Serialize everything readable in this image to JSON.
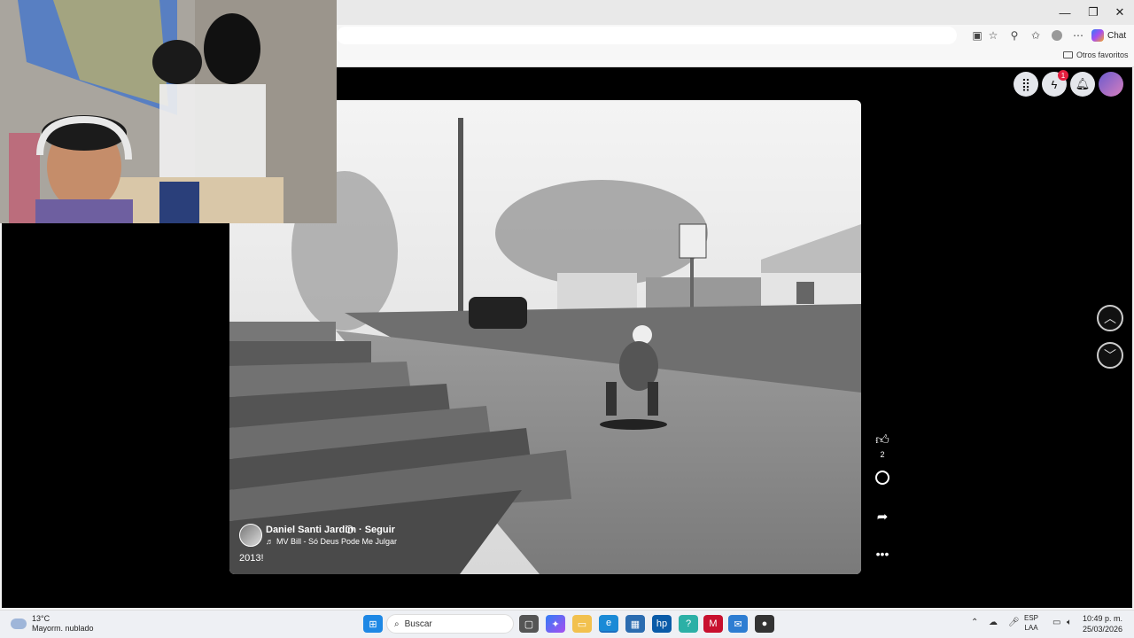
{
  "browser": {
    "chat_label": "Chat",
    "other_favorites": "Otros favoritos",
    "minimize": "—",
    "maximize": "❐",
    "close": "✕"
  },
  "facebook": {
    "messenger_badge": "1",
    "like_count": "2",
    "author": "Daniel Santi Jardim",
    "follow": "· Seguir",
    "music": "MV Bill - Só Deus Pode Me Julgar",
    "caption": "2013!"
  },
  "taskbar": {
    "temperature": "13°C",
    "weather": "Mayorm. nublado",
    "search_placeholder": "Buscar",
    "lang_top": "ESP",
    "lang_bottom": "LAA",
    "time": "10:49 p. m.",
    "date": "25/03/2026"
  },
  "icons": [
    "grid-icon",
    "messenger-icon",
    "bell-icon",
    "like-icon",
    "comment-icon",
    "share-icon",
    "more-icon",
    "chevron-up-icon",
    "chevron-down-icon",
    "music-icon",
    "verified-icon",
    "search-icon",
    "windows-icon"
  ],
  "colors": {
    "viewer_bg": "#000000",
    "badge": "#e41e3f",
    "taskbar": "#eef0f4"
  }
}
